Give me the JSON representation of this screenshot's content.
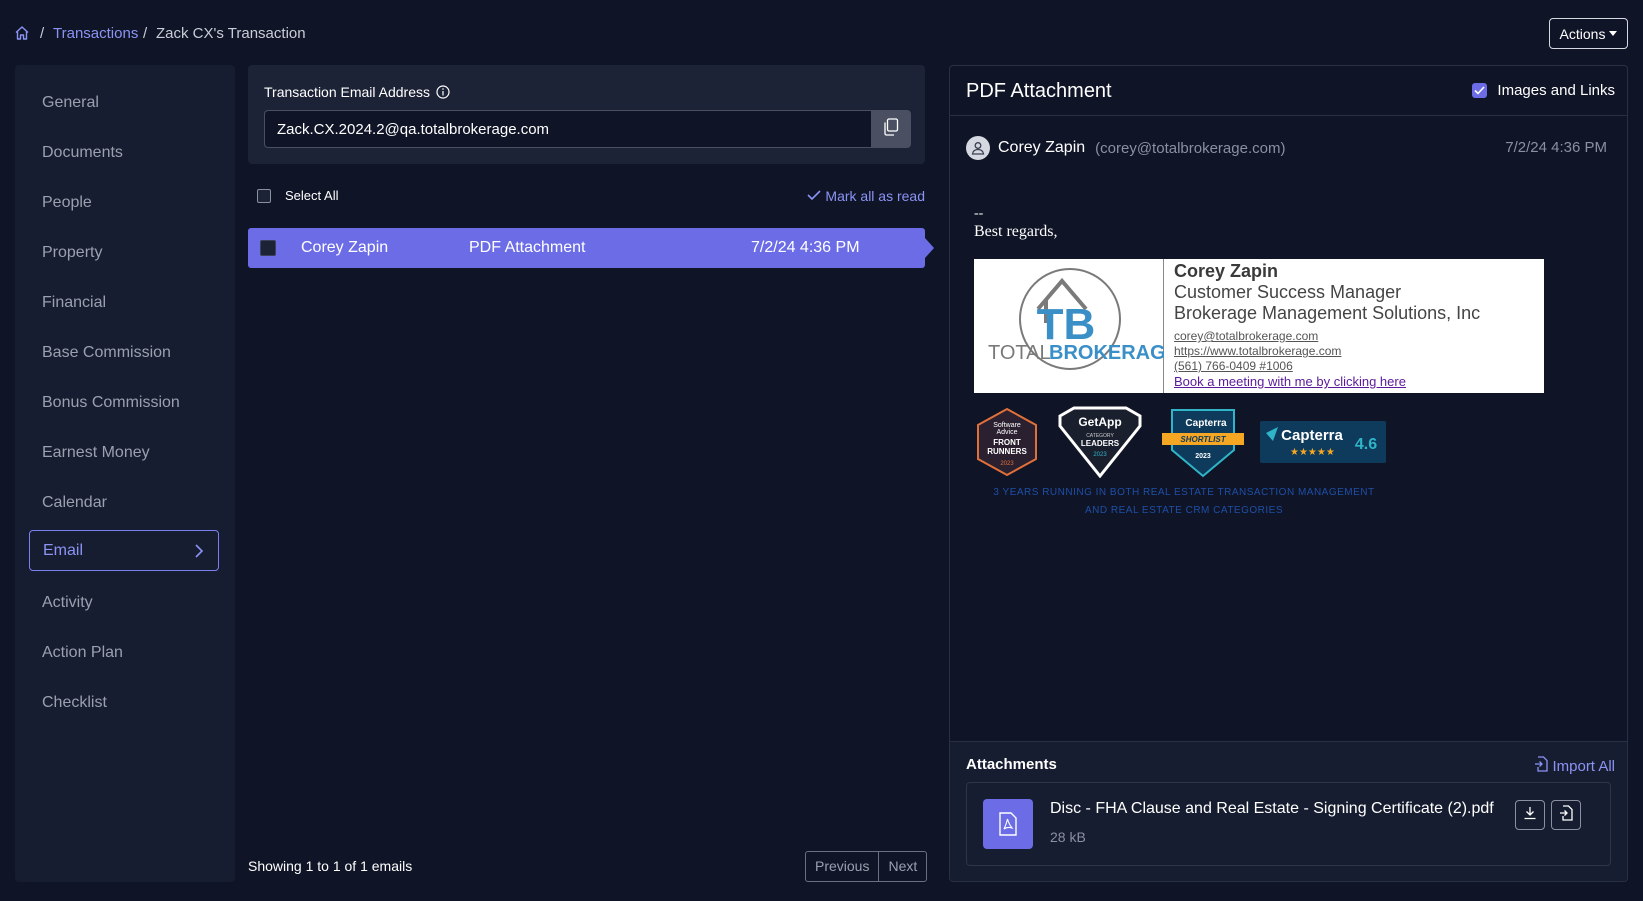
{
  "breadcrumb": {
    "separator": "/",
    "link": "Transactions",
    "current": "Zack CX's Transaction"
  },
  "header": {
    "actions_label": "Actions"
  },
  "sidebar": {
    "items": [
      {
        "label": "General"
      },
      {
        "label": "Documents"
      },
      {
        "label": "People"
      },
      {
        "label": "Property"
      },
      {
        "label": "Financial"
      },
      {
        "label": "Base Commission"
      },
      {
        "label": "Bonus Commission"
      },
      {
        "label": "Earnest Money"
      },
      {
        "label": "Calendar"
      },
      {
        "label": "Email",
        "active": true
      },
      {
        "label": "Activity"
      },
      {
        "label": "Action Plan"
      },
      {
        "label": "Checklist"
      }
    ]
  },
  "email_address": {
    "label": "Transaction Email Address",
    "value": "Zack.CX.2024.2@qa.totalbrokerage.com"
  },
  "list": {
    "select_all": "Select All",
    "mark_all_read": "Mark all as read",
    "rows": [
      {
        "from": "Corey Zapin",
        "subject": "PDF Attachment",
        "date": "7/2/24 4:36 PM"
      }
    ],
    "showing": "Showing 1 to 1 of 1 emails",
    "previous": "Previous",
    "next": "Next"
  },
  "preview": {
    "title": "PDF Attachment",
    "images_links_label": "Images and Links",
    "sender_name": "Corey Zapin",
    "sender_email": "(corey@totalbrokerage.com)",
    "date": "7/2/24 4:36 PM",
    "body_dash": "--",
    "body_regards": "Best regards,",
    "signature": {
      "logo_text_total": "TOTAL",
      "logo_text_brokerage": "BROKERAGE",
      "logo_mark": "TB",
      "name": "Corey Zapin",
      "role": "Customer Success Manager",
      "company": "Brokerage Management Solutions, Inc",
      "email": "corey@totalbrokerage.com",
      "website": "https://www.totalbrokerage.com",
      "phone": "(561) 766-0409 #1006",
      "meeting": "Book a meeting with me by clicking here"
    },
    "badges": {
      "sa_line1": "Software",
      "sa_line2": "Advice",
      "sa_line3": "FRONT",
      "sa_line4": "RUNNERS",
      "sa_year": "2023",
      "ga_brand": "GetApp",
      "ga_line1": "CATEGORY",
      "ga_line2": "LEADERS",
      "ga_year": "2023",
      "cs_brand": "Capterra",
      "cs_ribbon": "SHORTLIST",
      "cs_year": "2023",
      "cr_brand": "Capterra",
      "cr_score": "4.6"
    },
    "award_line1": "3 YEARS RUNNING IN BOTH REAL ESTATE TRANSACTION MANAGEMENT",
    "award_line2": "AND REAL ESTATE CRM CATEGORIES"
  },
  "attachments": {
    "title": "Attachments",
    "import_all": "Import All",
    "items": [
      {
        "name": "Disc - FHA Clause and Real Estate - Signing Certificate (2).pdf",
        "size": "28 kB"
      }
    ]
  },
  "colors": {
    "accent": "#6c6de6",
    "link": "#8b93f5",
    "background": "#0f1426",
    "panel": "#171d30"
  }
}
